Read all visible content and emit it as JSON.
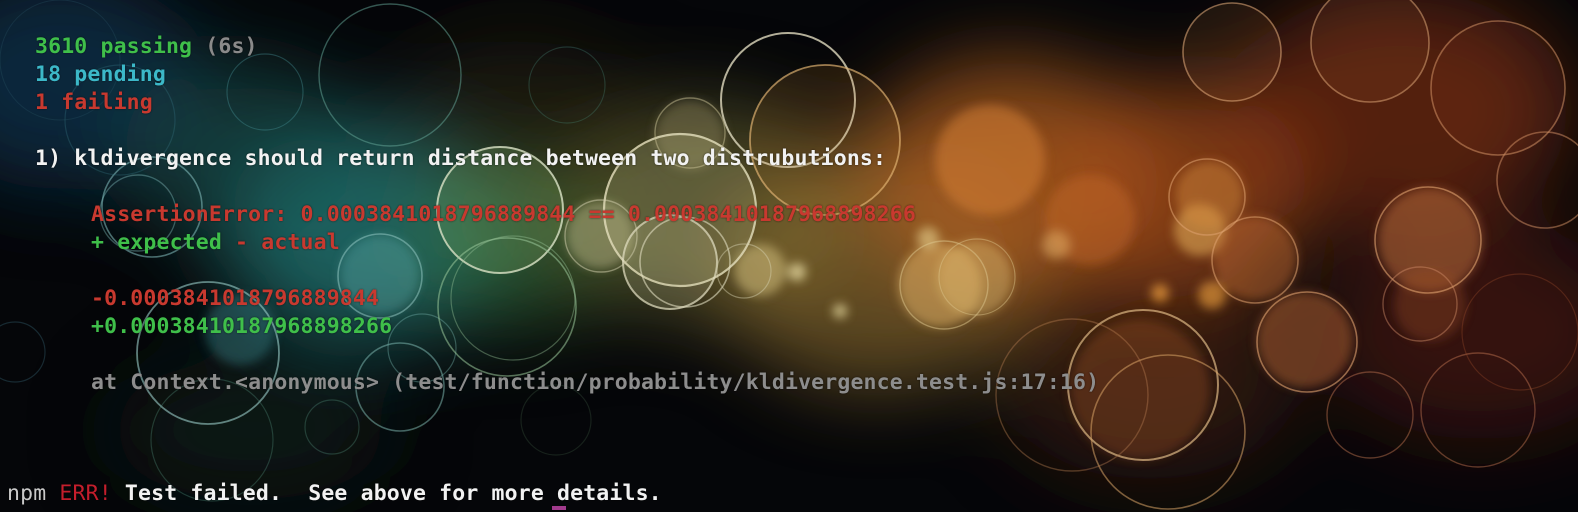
{
  "summary": {
    "passing_count": "3610",
    "passing_word": " passing",
    "duration": " (6s)",
    "pending_count": "18",
    "pending_word": " pending",
    "failing": "1 failing"
  },
  "failure": {
    "title": "1) kldivergence should return distance between two distrubutions:",
    "error": "AssertionError: 0.0003841018796889844 == 0.00038410187968898266",
    "legend_expected": "+ expected",
    "legend_actual": " - actual",
    "actual_value": "-0.0003841018796889844",
    "expected_value": "+0.00038410187968898266",
    "stack": "at Context.<anonymous> (test/function/probability/kldivergence.test.js:17:16)"
  },
  "npm": {
    "prefix": "npm",
    "err": "ERR!",
    "message": "Test failed.  See above for more details."
  },
  "colors": {
    "passing": "#3fbf4a",
    "pending": "#3cb8c8",
    "failing": "#c8392f",
    "text": "#f2f2f2",
    "stack": "#8d8d8d"
  }
}
